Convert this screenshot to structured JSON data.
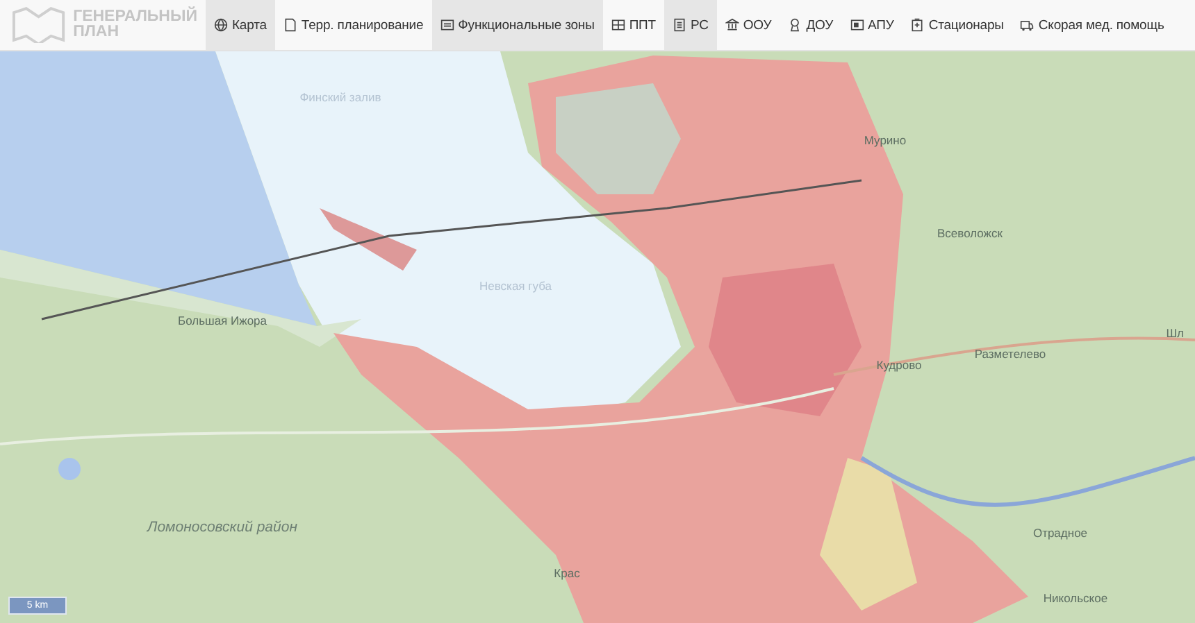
{
  "logo": {
    "line_1": "ГЕНЕРАЛЬНЫЙ",
    "line_2": "ПЛАН"
  },
  "tabs": [
    {
      "label": "Карта",
      "selected": true
    },
    {
      "label": "Терр. планирование",
      "selected": false
    },
    {
      "label": "Функциональные зоны",
      "selected": true
    },
    {
      "label": "ППТ",
      "selected": false
    },
    {
      "label": "РС",
      "selected": true
    },
    {
      "label": "ООУ",
      "selected": false
    },
    {
      "label": "ДОУ",
      "selected": false
    },
    {
      "label": "АПУ",
      "selected": false
    },
    {
      "label": "Стационары",
      "selected": false
    },
    {
      "label": "Скорая мед. помощь",
      "selected": false
    }
  ],
  "map": {
    "labels": [
      {
        "text": "Финский залив",
        "kind": "water"
      },
      {
        "text": "Невская губа",
        "kind": "water"
      },
      {
        "text": "Большая Ижора",
        "kind": "place"
      },
      {
        "text": "Ломоносовский район",
        "kind": "district"
      },
      {
        "text": "Мурино",
        "kind": "place"
      },
      {
        "text": "Всеволожск",
        "kind": "place"
      },
      {
        "text": "Кудрово",
        "kind": "place"
      },
      {
        "text": "Разметелево",
        "kind": "place"
      },
      {
        "text": "Отрадное",
        "kind": "place"
      },
      {
        "text": "Никольское",
        "kind": "place"
      },
      {
        "text": "Крас",
        "kind": "place"
      },
      {
        "text": "Шл",
        "kind": "place"
      }
    ],
    "scale": "5 km"
  }
}
